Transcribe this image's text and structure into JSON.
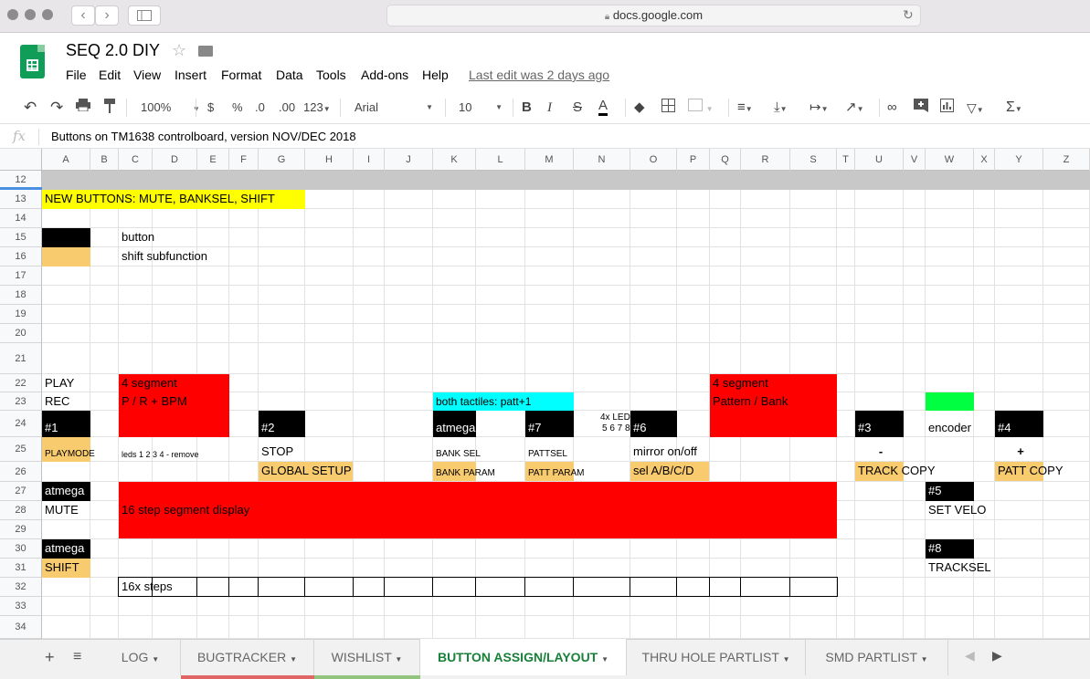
{
  "browser": {
    "url": "docs.google.com",
    "back_icon": "‹",
    "forward_icon": "›"
  },
  "doc": {
    "title": "SEQ 2.0 DIY",
    "last_edit": "Last edit was 2 days ago"
  },
  "menu": [
    "File",
    "Edit",
    "View",
    "Insert",
    "Format",
    "Data",
    "Tools",
    "Add-ons",
    "Help"
  ],
  "toolbar": {
    "zoom": "100%",
    "currency": "$",
    "percent": "%",
    "dec_less": ".0",
    "dec_more": ".00",
    "format_more": "123",
    "font": "Arial",
    "font_size": "10"
  },
  "formula_bar": {
    "fx": "fx",
    "value": "Buttons on TM1638 controlboard, version NOV/DEC 2018"
  },
  "columns": [
    "A",
    "B",
    "C",
    "D",
    "E",
    "F",
    "G",
    "H",
    "I",
    "J",
    "K",
    "L",
    "M",
    "N",
    "O",
    "P",
    "Q",
    "R",
    "S",
    "T",
    "U",
    "V",
    "W",
    "X",
    "Y",
    "Z"
  ],
  "rows": [
    "12",
    "13",
    "14",
    "15",
    "16",
    "17",
    "18",
    "19",
    "20",
    "21",
    "22",
    "23",
    "24",
    "25",
    "26",
    "27",
    "28",
    "29",
    "30",
    "31",
    "32",
    "33",
    "34"
  ],
  "cells": {
    "r13": "NEW BUTTONS:  MUTE,  BANKSEL,  SHIFT",
    "c15": "button",
    "c16": "shift subfunction",
    "a22": "PLAY",
    "a23": "REC",
    "seg1_line1": "4 segment",
    "seg1_line2": "P / R  + BPM",
    "a24": "#1",
    "a25": "PLAYMODE",
    "c25": "leds 1 2 3 4 - remove",
    "a27": "atmega",
    "a28": "MUTE",
    "seg16": "16 step segment display",
    "a30": "atmega",
    "a31": "SHIFT",
    "c32": "16x steps",
    "g24": "#2",
    "g25": "STOP",
    "g26": "GLOBAL SETUP",
    "k23": "both tactiles: patt+1",
    "k24": "atmega",
    "k25": "BANK SEL",
    "k26": "BANK PARAM",
    "m24": "#7",
    "m25": "PATTSEL",
    "m26": "PATT PARAM",
    "n24a": "4x LED",
    "n24b": "5 6 7 8",
    "o24": "#6",
    "o25": "mirror on/off",
    "o26": "sel A/B/C/D",
    "seg2_line1": "4 segment",
    "seg2_line2": "Pattern / Bank",
    "u24": "#3",
    "u25": "-",
    "u26": "TRACK COPY",
    "w24": "encoder",
    "w27": "#5",
    "w28": "SET VELO",
    "w30": "#8",
    "w31": "TRACKSEL",
    "y24": "#4",
    "y25": "+",
    "y26": "PATT COPY"
  },
  "sheet_tabs": [
    "LOG",
    "BUGTRACKER",
    "WISHLIST",
    "BUTTON ASSIGN/LAYOUT",
    "THRU HOLE PARTLIST",
    "SMD PARTLIST"
  ],
  "colors": {
    "red": "#ff0000",
    "yellow": "#ffff00",
    "orange": "#f9cb6f",
    "cyan": "#00ffff",
    "green": "#00ff40",
    "black": "#000000",
    "active_tab": "#188038"
  }
}
